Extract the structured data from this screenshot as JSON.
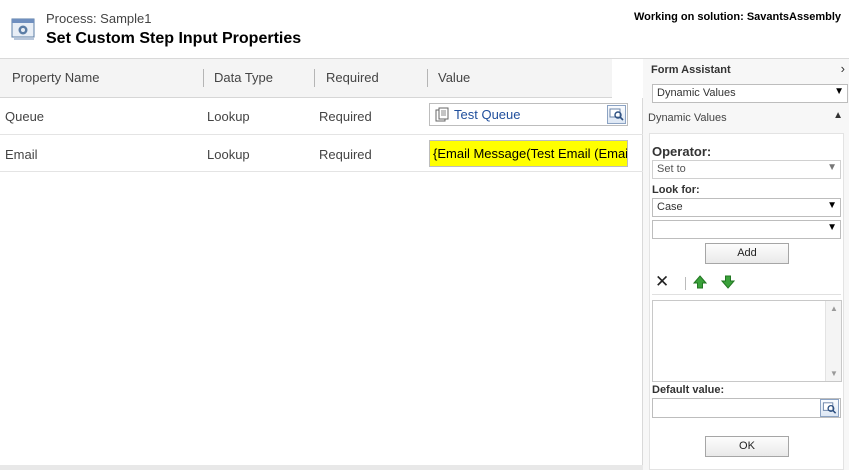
{
  "header": {
    "process_label": "Process: Sample1",
    "title": "Set Custom Step Input Properties",
    "solution": "Working on solution: SavantsAssembly"
  },
  "grid": {
    "columns": [
      "Property Name",
      "Data Type",
      "Required",
      "Value"
    ],
    "rows": [
      {
        "name": "Queue",
        "type": "Lookup",
        "required": "Required",
        "value": "Test Queue"
      },
      {
        "name": "Email",
        "type": "Lookup",
        "required": "Required",
        "value": "{Email Message(Test Email (Email))}"
      }
    ]
  },
  "assistant": {
    "title": "Form Assistant",
    "mode_select": "Dynamic Values",
    "section_label": "Dynamic Values",
    "operator_label": "Operator:",
    "operator_value": "Set to",
    "look_for_label": "Look for:",
    "look_for_value": "Case",
    "field_value": "",
    "add_label": "Add",
    "default_value_label": "Default value:",
    "default_value": "",
    "ok_label": "OK"
  },
  "colors": {
    "highlight": "#ffff00",
    "link": "#1f4e9c"
  }
}
